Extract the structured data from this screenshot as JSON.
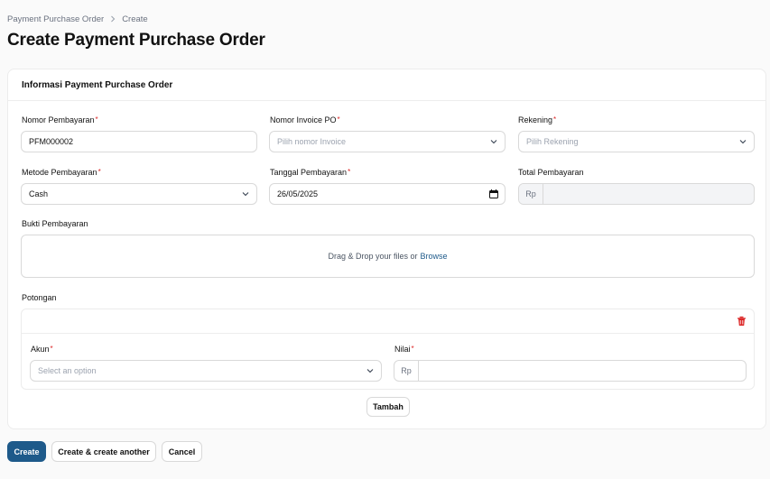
{
  "breadcrumb": {
    "parent": "Payment Purchase Order",
    "current": "Create"
  },
  "page_title": "Create Payment Purchase Order",
  "section": {
    "title": "Informasi Payment Purchase Order",
    "fields": {
      "nomor_pembayaran": {
        "label": "Nomor Pembayaran",
        "value": "PFM000002",
        "required": true
      },
      "nomor_invoice_po": {
        "label": "Nomor Invoice PO",
        "placeholder": "Pilih nomor Invoice",
        "required": true
      },
      "rekening": {
        "label": "Rekening",
        "placeholder": "Pilih Rekening",
        "required": true
      },
      "metode_pembayaran": {
        "label": "Metode Pembayaran",
        "value": "Cash",
        "required": true
      },
      "tanggal_pembayaran": {
        "label": "Tanggal Pembayaran",
        "value": "26/05/2025",
        "required": true
      },
      "total_pembayaran": {
        "label": "Total Pembayaran",
        "prefix": "Rp",
        "value": ""
      }
    },
    "bukti": {
      "label": "Bukti Pembayaran",
      "dropzone_text": "Drag & Drop your files or",
      "browse_label": "Browse"
    },
    "potongan": {
      "label": "Potongan",
      "item": {
        "akun": {
          "label": "Akun",
          "placeholder": "Select an option"
        },
        "nilai": {
          "label": "Nilai",
          "prefix": "Rp",
          "value": ""
        }
      },
      "add_label": "Tambah"
    },
    "required_mark": "*"
  },
  "actions": {
    "create": "Create",
    "create_another": "Create & create another",
    "cancel": "Cancel"
  },
  "colors": {
    "primary": "#1e5a8a",
    "required": "#dc2626",
    "danger": "#dc2626"
  },
  "icons": [
    "chevron-right-icon",
    "chevron-down-icon",
    "calendar-icon",
    "trash-icon"
  ]
}
